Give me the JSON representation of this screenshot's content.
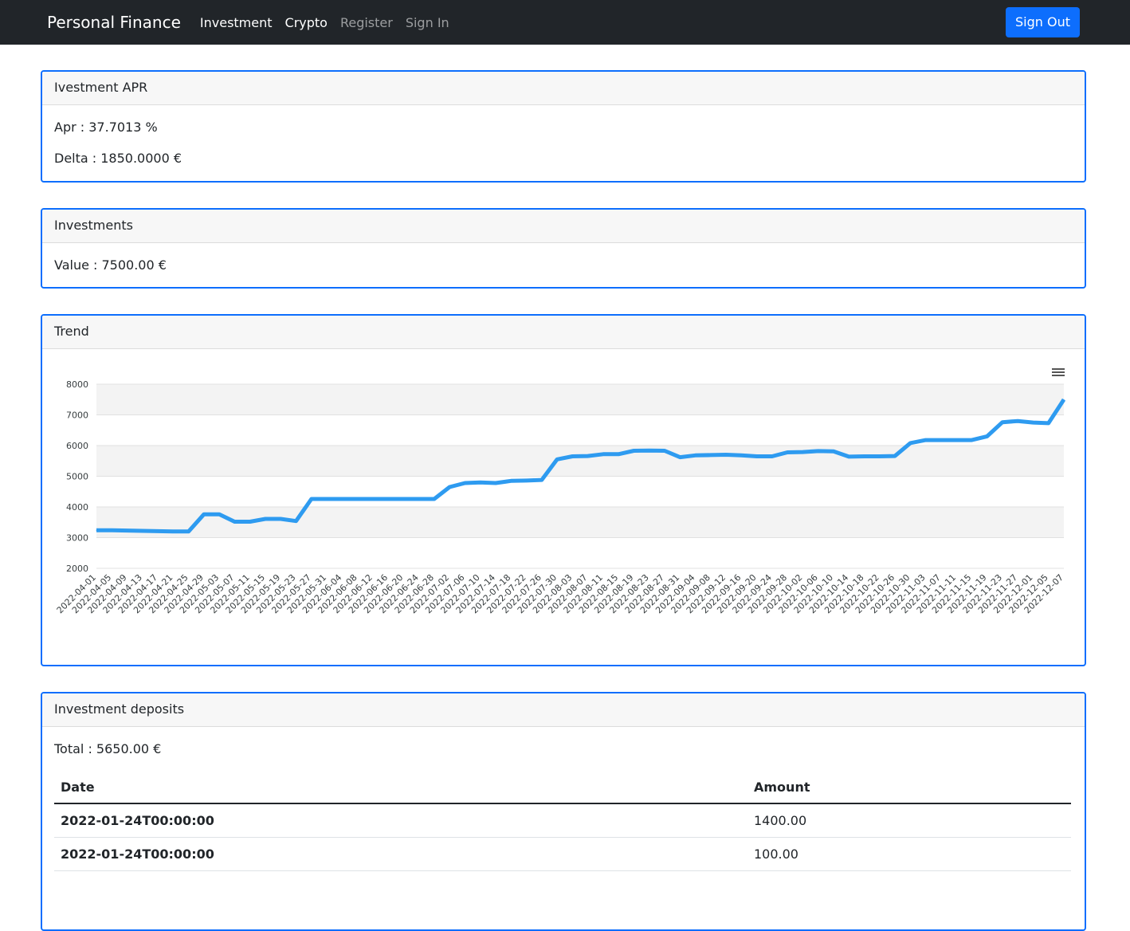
{
  "nav": {
    "brand": "Personal Finance",
    "links": [
      {
        "label": "Investment",
        "state": "active"
      },
      {
        "label": "Crypto",
        "state": "active"
      },
      {
        "label": "Register",
        "state": "muted"
      },
      {
        "label": "Sign In",
        "state": "muted"
      }
    ],
    "signout_label": "Sign Out"
  },
  "apr_card": {
    "title": "Ivestment APR",
    "apr_label": "Apr : 37.7013 %",
    "delta_label": "Delta : 1850.0000 €"
  },
  "investments_card": {
    "title": "Investments",
    "value_label": "Value : 7500.00 €"
  },
  "trend_card": {
    "title": "Trend",
    "menu_icon": "hamburger-menu-icon"
  },
  "deposits_card": {
    "title": "Investment deposits",
    "total_label": "Total : 5650.00 €",
    "columns": [
      "Date",
      "Amount"
    ],
    "rows": [
      {
        "date": "2022-01-24T00:00:00",
        "amount": "1400.00"
      },
      {
        "date": "2022-01-24T00:00:00",
        "amount": "100.00"
      }
    ]
  },
  "colors": {
    "navbar_bg": "#212529",
    "accent": "#0d6efd",
    "line": "#2e9bf0"
  },
  "chart_data": {
    "type": "line",
    "title": "",
    "xlabel": "",
    "ylabel": "",
    "ylim": [
      2000,
      8000
    ],
    "yticks": [
      2000,
      3000,
      4000,
      5000,
      6000,
      7000,
      8000
    ],
    "grid": true,
    "x": [
      "2022-04-01",
      "2022-04-05",
      "2022-04-09",
      "2022-04-13",
      "2022-04-17",
      "2022-04-21",
      "2022-04-25",
      "2022-04-29",
      "2022-05-03",
      "2022-05-07",
      "2022-05-11",
      "2022-05-15",
      "2022-05-19",
      "2022-05-23",
      "2022-05-27",
      "2022-05-31",
      "2022-06-04",
      "2022-06-08",
      "2022-06-12",
      "2022-06-16",
      "2022-06-20",
      "2022-06-24",
      "2022-06-28",
      "2022-07-02",
      "2022-07-06",
      "2022-07-10",
      "2022-07-14",
      "2022-07-18",
      "2022-07-22",
      "2022-07-26",
      "2022-07-30",
      "2022-08-03",
      "2022-08-07",
      "2022-08-11",
      "2022-08-15",
      "2022-08-19",
      "2022-08-23",
      "2022-08-27",
      "2022-08-31",
      "2022-09-04",
      "2022-09-08",
      "2022-09-12",
      "2022-09-16",
      "2022-09-20",
      "2022-09-24",
      "2022-09-28",
      "2022-10-02",
      "2022-10-06",
      "2022-10-10",
      "2022-10-14",
      "2022-10-18",
      "2022-10-22",
      "2022-10-26",
      "2022-10-30",
      "2022-11-03",
      "2022-11-07",
      "2022-11-11",
      "2022-11-15",
      "2022-11-19",
      "2022-11-23",
      "2022-11-27",
      "2022-12-01",
      "2022-12-05",
      "2022-12-07"
    ],
    "series": [
      {
        "values": [
          3240,
          3240,
          3230,
          3220,
          3210,
          3200,
          3200,
          3760,
          3760,
          3520,
          3520,
          3610,
          3610,
          3540,
          4260,
          4260,
          4260,
          4260,
          4260,
          4260,
          4260,
          4260,
          4260,
          4650,
          4780,
          4800,
          4780,
          4850,
          4860,
          4880,
          5550,
          5650,
          5660,
          5720,
          5720,
          5830,
          5840,
          5830,
          5620,
          5680,
          5690,
          5700,
          5680,
          5650,
          5650,
          5780,
          5790,
          5820,
          5810,
          5640,
          5650,
          5650,
          5660,
          6080,
          6180,
          6180,
          6180,
          6180,
          6300,
          6760,
          6800,
          6750,
          6730,
          7500
        ],
        "color": "#2e9bf0"
      }
    ]
  }
}
